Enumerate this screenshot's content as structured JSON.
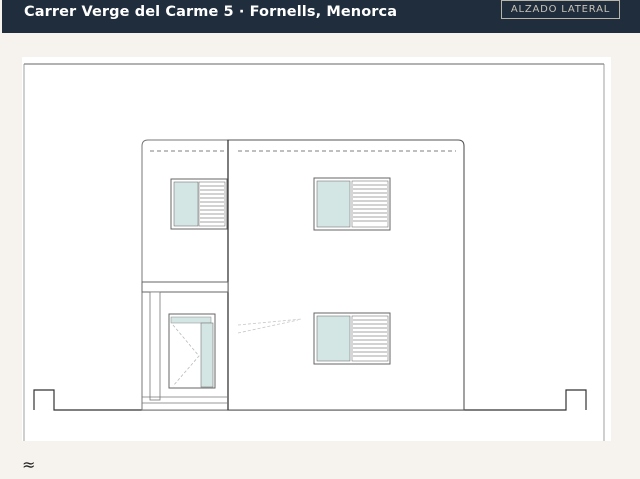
{
  "header": {
    "title": "Carrer Verge del Carme 5 · Fornells, Menorca",
    "view_label": "ALZADO LATERAL"
  },
  "colors": {
    "header_bg": "#1f2d3d",
    "page_bg": "#f6f3ee",
    "sheet_bg": "#ffffff",
    "line": "#555555",
    "glass": "#d3e6e4"
  },
  "footer": {
    "logo_icon": "wave-icon"
  }
}
